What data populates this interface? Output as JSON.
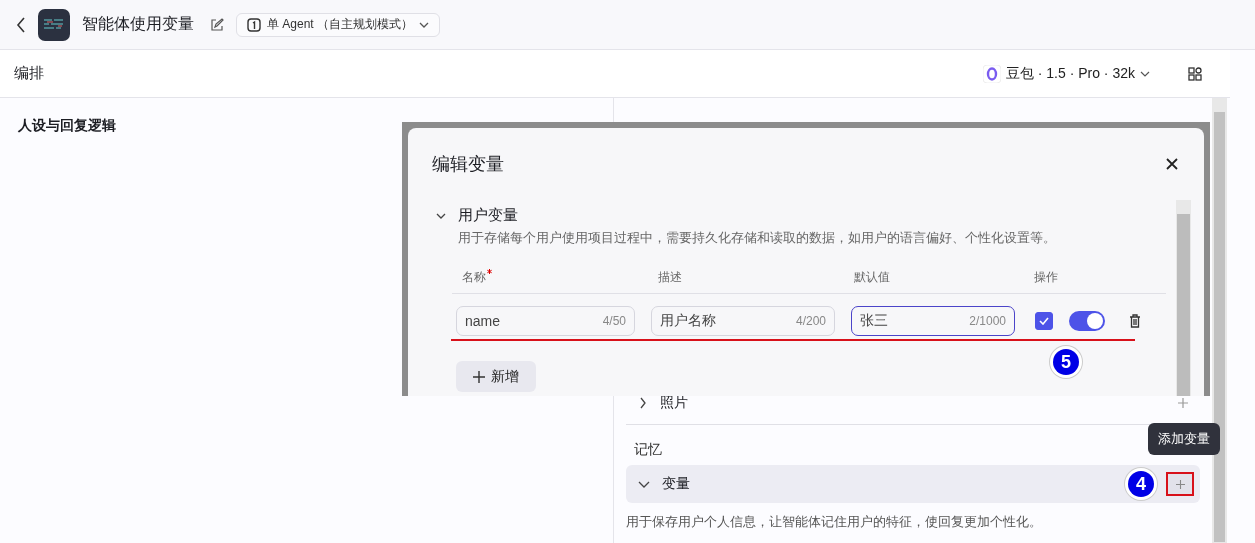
{
  "header": {
    "title": "智能体使用变量",
    "mode": "单 Agent （自主规划模式）"
  },
  "toolbar": {
    "title": "编排",
    "model": "豆包 · 1.5 · Pro · 32k"
  },
  "persona": {
    "title": "人设与回复逻辑"
  },
  "sections": [
    {
      "title": "照片",
      "expanded": false
    }
  ],
  "memory": {
    "title": "记忆",
    "variable": {
      "title": "变量",
      "expanded": true,
      "description": "用于保存用户个人信息，让智能体记住用户的特征，使回复更加个性化。"
    },
    "tooltip": "添加变量"
  },
  "dialog": {
    "title": "编辑变量",
    "section": {
      "title": "用户变量",
      "expanded": true,
      "description": "用于存储每个用户使用项目过程中，需要持久化存储和读取的数据，如用户的语言偏好、个性化设置等。"
    },
    "columns": [
      {
        "label": "名称",
        "required": true
      },
      {
        "label": "描述",
        "required": false
      },
      {
        "label": "默认值",
        "required": false
      },
      {
        "label": "操作",
        "required": false
      }
    ],
    "rows": [
      {
        "name": {
          "value": "name",
          "count": "4/50"
        },
        "description": {
          "value": "用户名称",
          "count": "4/200"
        },
        "default": {
          "value": "张三",
          "count": "2/1000",
          "focused": true
        },
        "checked": true,
        "on": true
      }
    ],
    "add_button": "新增"
  },
  "annotations": [
    "5",
    "4"
  ]
}
